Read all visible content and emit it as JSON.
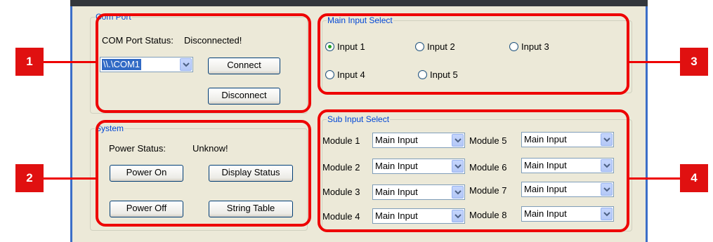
{
  "com_port": {
    "title": "Com Port",
    "status_label": "COM Port Status:",
    "status_value": "Disconnected!",
    "port_select": {
      "value": "\\\\.\\COM1"
    },
    "connect_label": "Connect",
    "disconnect_label": "Disconnect"
  },
  "system": {
    "title": "System",
    "power_status_label": "Power Status:",
    "power_status_value": "Unknow!",
    "power_on_label": "Power On",
    "display_status_label": "Display Status",
    "power_off_label": "Power Off",
    "string_table_label": "String Table"
  },
  "main_input": {
    "title": "Main Input Select",
    "options": [
      "Input 1",
      "Input 2",
      "Input 3",
      "Input 4",
      "Input 5"
    ],
    "selected": "Input 1"
  },
  "sub_input": {
    "title": "Sub Input Select",
    "modules": [
      {
        "label": "Module 1",
        "value": "Main Input"
      },
      {
        "label": "Module 2",
        "value": "Main Input"
      },
      {
        "label": "Module 3",
        "value": "Main Input"
      },
      {
        "label": "Module 4",
        "value": "Main Input"
      },
      {
        "label": "Module 5",
        "value": "Main Input"
      },
      {
        "label": "Module 6",
        "value": "Main Input"
      },
      {
        "label": "Module 7",
        "value": "Main Input"
      },
      {
        "label": "Module 8",
        "value": "Main Input"
      }
    ]
  },
  "callouts": [
    "1",
    "2",
    "3",
    "4"
  ],
  "colors": {
    "callout": "#ee0000",
    "group_title": "#0046d5",
    "radio_dot": "#21a121",
    "dialog_bg": "#ece9d8"
  }
}
